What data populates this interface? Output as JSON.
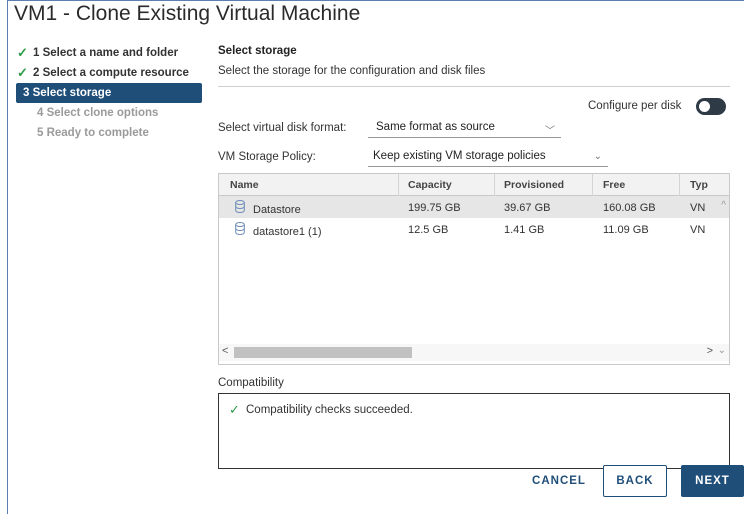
{
  "window": {
    "title": "VM1 - Clone Existing Virtual Machine"
  },
  "steps": [
    {
      "label": "1 Select a name and folder",
      "state": "done"
    },
    {
      "label": "2 Select a compute resource",
      "state": "done"
    },
    {
      "label": "3 Select storage",
      "state": "active"
    },
    {
      "label": "4 Select clone options",
      "state": "disabled"
    },
    {
      "label": "5 Ready to complete",
      "state": "disabled"
    }
  ],
  "section": {
    "title": "Select storage",
    "description": "Select the storage for the configuration and disk files"
  },
  "per_disk": {
    "label": "Configure per disk",
    "enabled": false
  },
  "disk_format": {
    "label": "Select virtual disk format:",
    "value": "Same format as source"
  },
  "storage_policy": {
    "label": "VM Storage Policy:",
    "value": "Keep existing VM storage policies"
  },
  "table": {
    "columns": [
      "Name",
      "Capacity",
      "Provisioned",
      "Free",
      "Typ"
    ],
    "rows": [
      {
        "name": "Datastore",
        "capacity": "199.75 GB",
        "provisioned": "39.67 GB",
        "free": "160.08 GB",
        "type": "VN",
        "selected": true
      },
      {
        "name": "datastore1 (1)",
        "capacity": "12.5 GB",
        "provisioned": "1.41 GB",
        "free": "11.09 GB",
        "type": "VN",
        "selected": false
      }
    ]
  },
  "compatibility": {
    "label": "Compatibility",
    "message": "Compatibility checks succeeded."
  },
  "buttons": {
    "cancel": "CANCEL",
    "back": "BACK",
    "next": "NEXT"
  },
  "colors": {
    "accent": "#1f4e79",
    "success": "#2e9b46",
    "toggle_off": "#2f3a47"
  },
  "icons": {
    "check": "check-icon",
    "datastore": "database-icon",
    "dropdown": "chevron-down-icon"
  }
}
